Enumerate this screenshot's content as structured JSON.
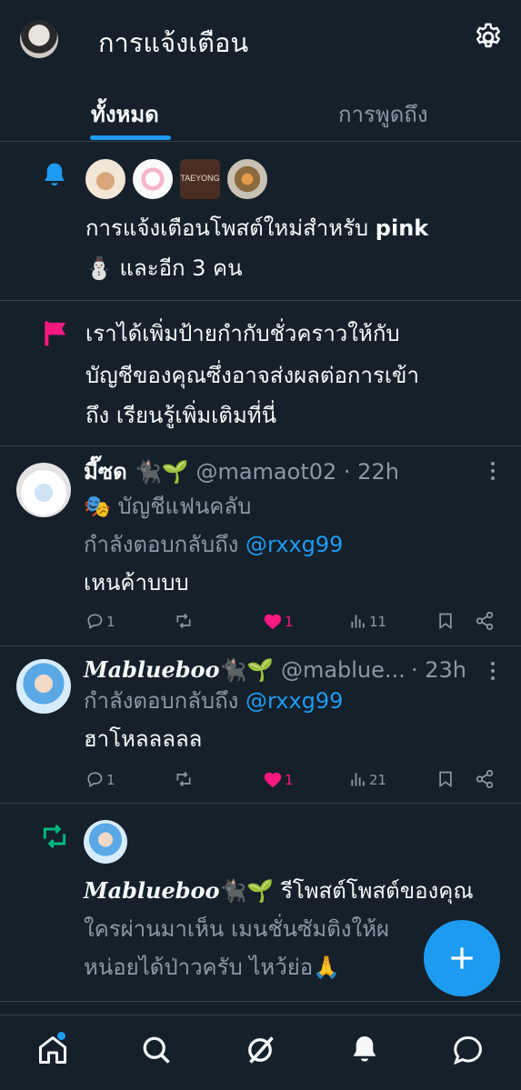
{
  "header": {
    "title": "การแจ้งเตือน",
    "settings_icon": "gear-icon"
  },
  "tabs": [
    {
      "label": "ทั้งหมด",
      "active": true
    },
    {
      "label": "การพูดถึง",
      "active": false
    }
  ],
  "accent_color": "#1d9bf0",
  "items": [
    {
      "type": "new_post",
      "icon": "bell-icon",
      "avatar_logo_text": "TAEYONG",
      "text_prefix": "การแจ้งเตือนโพสต์ใหม่สำหรับ",
      "text_name": "pink",
      "text_suffix": "⛄ และอีก 3 คน"
    },
    {
      "type": "label",
      "icon": "flag-icon",
      "line1": "เราได้เพิ่มป้ายกำกับชั่วคราวให้กับ",
      "line2": "บัญชีของคุณซึ่งอาจส่งผลต่อการเข้า",
      "line3": "ถึง เรียนรู้เพิ่มเติมที่นี่"
    },
    {
      "type": "reply",
      "name": "มี๊ซด 🐈‍⬛🌱",
      "handle": "@mamaot02",
      "time": "· 22h",
      "badge": "🎭 บัญชีแฟนคลับ",
      "reply_prefix": "กำลังตอบกลับถึง",
      "reply_to": "@rxxg99",
      "body": "เหนค้าบบบ",
      "replies": "1",
      "likes": "1",
      "views": "11"
    },
    {
      "type": "reply",
      "name": "Mablueboo",
      "name_emoji": "🐈‍⬛🌱",
      "handle": "@mablue...",
      "time": "· 23h",
      "reply_prefix": "กำลังตอบกลับถึง",
      "reply_to": "@rxxg99",
      "body": "ฮาโหลลลลล",
      "replies": "1",
      "likes": "1",
      "views": "21"
    },
    {
      "type": "repost",
      "icon": "retweet-icon",
      "name": "Mablueboo",
      "name_emoji": "🐈‍⬛🌱",
      "action": "รีโพสต์โพสต์ของคุณ",
      "line1": "ใครผ่านมาเห็น เมนชั่นซัมติงให้ผ",
      "line2": "หน่อยได้ป่าวครับ ไหว้ย่อ🙏"
    }
  ],
  "bottom_nav": [
    "home-icon",
    "search-icon",
    "grok-icon",
    "notifications-icon",
    "messages-icon"
  ]
}
